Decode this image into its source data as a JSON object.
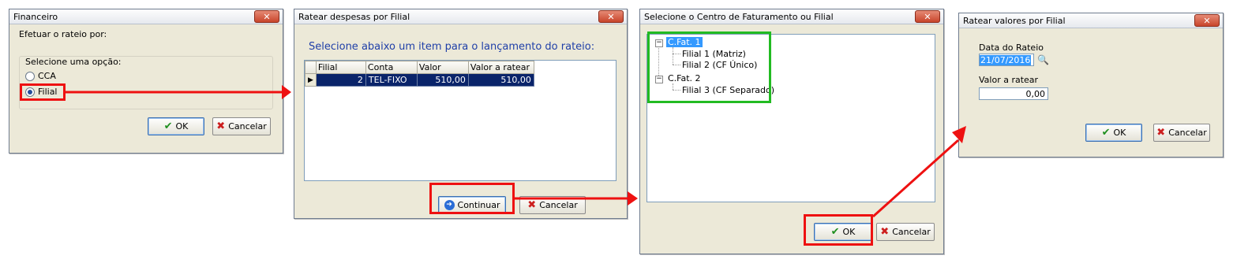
{
  "dialog1": {
    "title": "Financeiro",
    "prompt": "Efetuar o rateio por:",
    "group_label": "Selecione uma opção:",
    "options": [
      "CCA",
      "Filial"
    ],
    "selected": "Filial",
    "ok": "OK",
    "cancel": "Cancelar"
  },
  "dialog2": {
    "title": "Ratear despesas por Filial",
    "instruction": "Selecione abaixo um item para o lançamento do rateio:",
    "columns": [
      "Filial",
      "Conta",
      "Valor",
      "Valor a ratear"
    ],
    "rows": [
      {
        "filial": "2",
        "conta": "TEL-FIXO",
        "valor": "510,00",
        "valor_a_ratear": "510,00"
      }
    ],
    "continue": "Continuar",
    "cancel": "Cancelar"
  },
  "dialog3": {
    "title": "Selecione o Centro de Faturamento ou Filial",
    "tree": [
      {
        "label": "C.Fat. 1",
        "children": [
          "Filial 1 (Matriz)",
          "Filial 2 (CF Único)"
        ]
      },
      {
        "label": "C.Fat. 2",
        "children": [
          "Filial 3 (CF Separado)"
        ]
      }
    ],
    "ok": "OK",
    "cancel": "Cancelar"
  },
  "dialog4": {
    "title": "Ratear valores por Filial",
    "date_label": "Data do Rateio",
    "date_value": "21/07/2016",
    "amount_label": "Valor a ratear",
    "amount_value": "0,00",
    "ok": "OK",
    "cancel": "Cancelar"
  },
  "colors": {
    "highlight_red": "#ee1111",
    "highlight_green": "#22bb22",
    "selection_blue": "#0a246a",
    "instruction_blue": "#1f3fa8"
  }
}
